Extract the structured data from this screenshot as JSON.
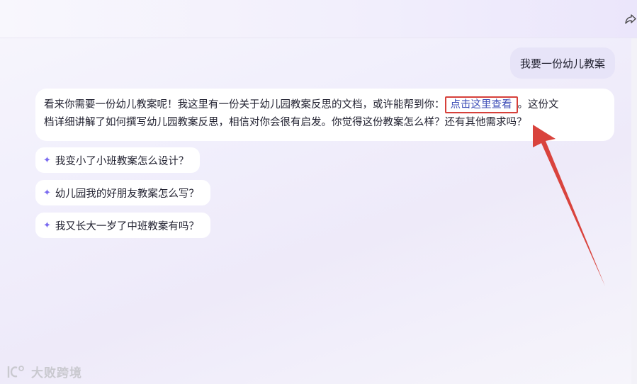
{
  "header": {
    "share_icon": "share-icon"
  },
  "conversation": {
    "user_message": "我要一份幼儿教案",
    "ai_message": {
      "line1_before": "看来你需要一份幼儿教案呢！我这里有一份关于幼儿园教案反思的文档，或许能帮到你：",
      "link_text": "点击这里查看",
      "line1_after": "。这份文",
      "line2": "档详细讲解了如何撰写幼儿园教案反思，相信对你会很有启发。你觉得这份教案怎么样？还有其他需求吗？"
    },
    "suggestions": [
      "我变小了小班教案怎么设计？",
      "幼儿园我的好朋友教案怎么写？",
      "我又长大一岁了中班教案有吗？"
    ]
  },
  "watermark": {
    "text": "大败跨境"
  },
  "colors": {
    "accent": "#7b6cf0",
    "link": "#3d4db7",
    "annotation": "#d6403a",
    "user_bubble": "#e7e4f8"
  }
}
